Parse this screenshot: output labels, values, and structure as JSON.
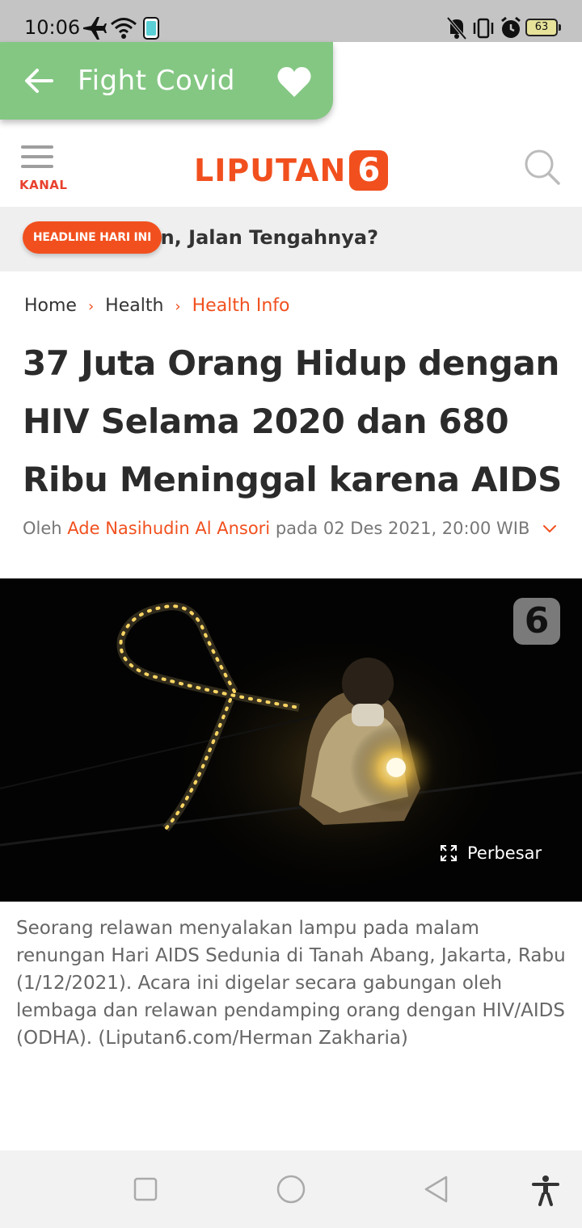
{
  "status_bar": {
    "time": "10:06",
    "battery": "63"
  },
  "topic_bar": {
    "title": "Fight Covid",
    "color": "#84c783"
  },
  "header": {
    "menu_label": "KANAL",
    "logo_text": "LIPUTAN",
    "logo_number": "6",
    "brand_color": "#f1501e"
  },
  "ticker": {
    "badge": "HEADLINE HARI INI",
    "text": "ggaran, Jalan Tengahnya?"
  },
  "breadcrumb": {
    "home": "Home",
    "section": "Health",
    "subsection": "Health Info"
  },
  "article": {
    "title": "37 Juta Orang Hidup dengan HIV Selama 2020 dan 680 Ribu Meninggal karena AIDS",
    "by_prefix": "Oleh",
    "author": "Ade Nasihudin Al Ansori",
    "date_text": "pada 02 Des 2021, 20:00 WIB",
    "image_badge": "6",
    "enlarge_label": "Perbesar",
    "caption": "Seorang relawan menyalakan lampu pada malam renungan Hari AIDS Sedunia di Tanah Abang, Jakarta, Rabu (1/12/2021). Acara ini digelar secara gabungan oleh lembaga dan relawan pendamping orang dengan HIV/AIDS (ODHA). (Liputan6.com/Herman Zakharia)"
  },
  "icons": {
    "status": [
      "airplane-icon",
      "wifi-icon",
      "phone-icon",
      "mute-icon",
      "vibrate-icon",
      "alarm-icon",
      "battery-icon"
    ],
    "nav": [
      "recents-icon",
      "home-icon",
      "back-icon",
      "accessibility-icon"
    ]
  }
}
